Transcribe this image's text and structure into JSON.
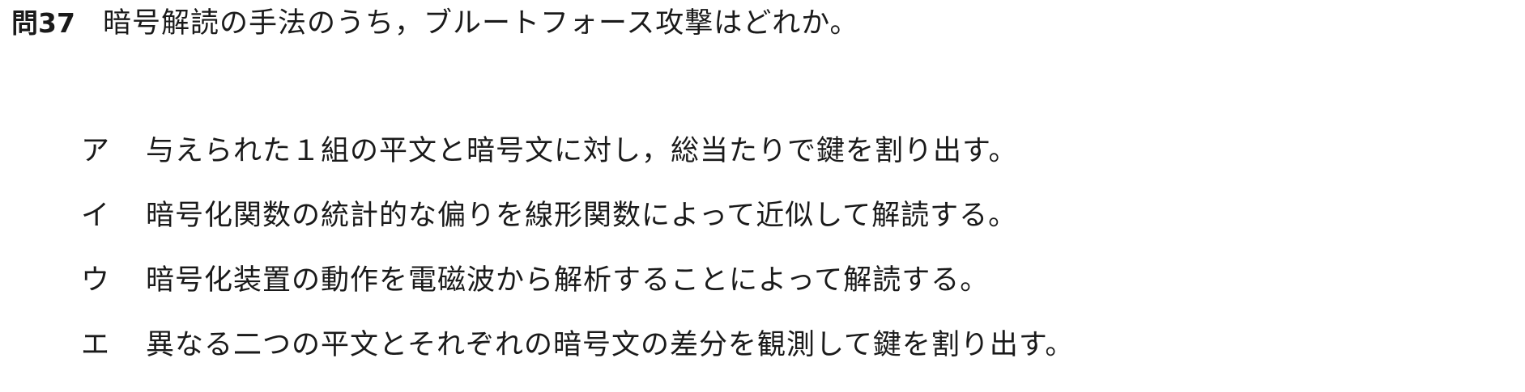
{
  "question": {
    "number": "問37",
    "text": "暗号解読の手法のうち，ブルートフォース攻撃はどれか。"
  },
  "choices": [
    {
      "label": "ア",
      "text": "与えられた１組の平文と暗号文に対し，総当たりで鍵を割り出す。"
    },
    {
      "label": "イ",
      "text": "暗号化関数の統計的な偏りを線形関数によって近似して解読する。"
    },
    {
      "label": "ウ",
      "text": "暗号化装置の動作を電磁波から解析することによって解読する。"
    },
    {
      "label": "エ",
      "text": "異なる二つの平文とそれぞれの暗号文の差分を観測して鍵を割り出す。"
    }
  ]
}
